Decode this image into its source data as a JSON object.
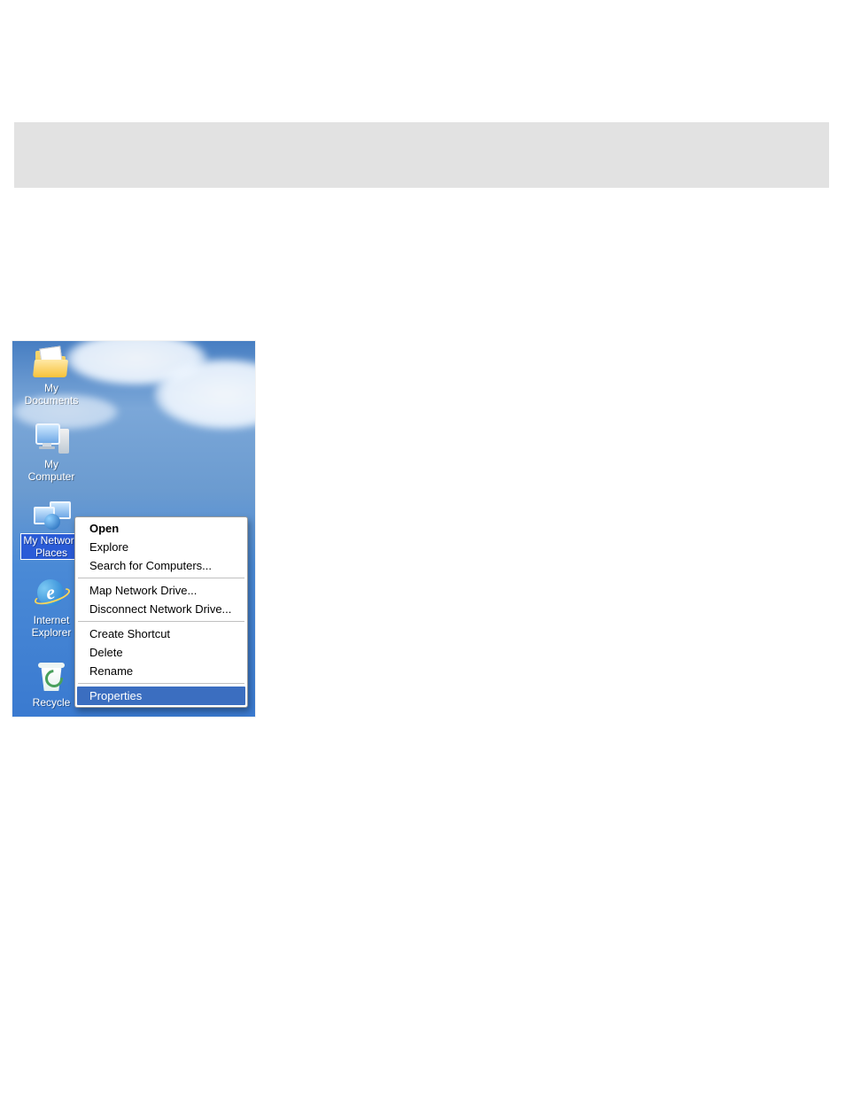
{
  "desktop": {
    "icons": [
      {
        "id": "my-documents",
        "label": "My Documents"
      },
      {
        "id": "my-computer",
        "label": "My Computer"
      },
      {
        "id": "my-network-places",
        "label": "My Network\nPlaces",
        "selected": true
      },
      {
        "id": "internet-explorer",
        "label": "Internet\nExplorer"
      },
      {
        "id": "recycle-bin",
        "label": "Recycle"
      }
    ]
  },
  "context_menu": {
    "groups": [
      [
        {
          "label": "Open",
          "bold": true
        },
        {
          "label": "Explore"
        },
        {
          "label": "Search for Computers..."
        }
      ],
      [
        {
          "label": "Map Network Drive..."
        },
        {
          "label": "Disconnect Network Drive..."
        }
      ],
      [
        {
          "label": "Create Shortcut"
        },
        {
          "label": "Delete"
        },
        {
          "label": "Rename"
        }
      ],
      [
        {
          "label": "Properties",
          "highlight": true
        }
      ]
    ]
  }
}
